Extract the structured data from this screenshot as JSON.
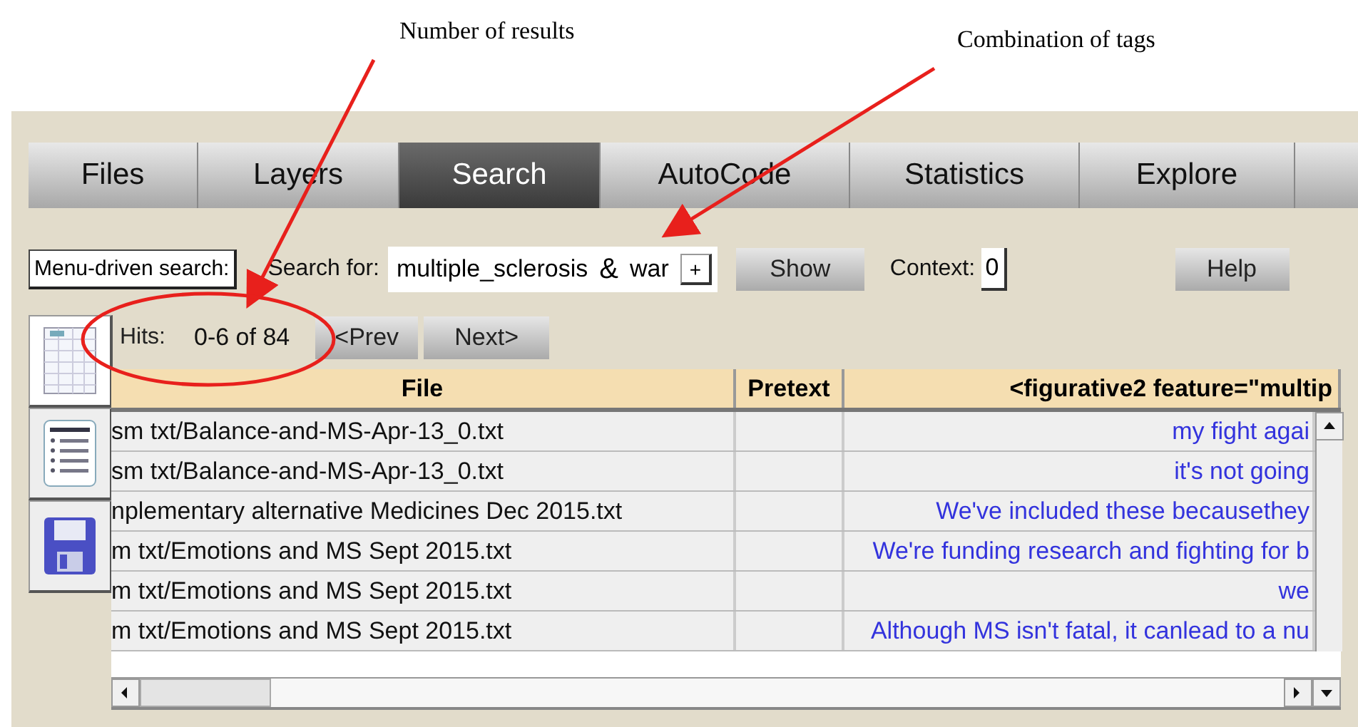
{
  "annotations": [
    {
      "label": "Number of results"
    },
    {
      "label": "Combination of tags"
    }
  ],
  "tabs": [
    {
      "label": "Files",
      "selected": false
    },
    {
      "label": "Layers",
      "selected": false
    },
    {
      "label": "Search",
      "selected": true
    },
    {
      "label": "AutoCode",
      "selected": false
    },
    {
      "label": "Statistics",
      "selected": false
    },
    {
      "label": "Explore",
      "selected": false
    }
  ],
  "search_bar": {
    "mode_button": "Menu-driven search:",
    "search_label": "Search for:",
    "terms": [
      "multiple_sclerosis",
      "war"
    ],
    "operator": "&",
    "add_button": "+",
    "show_button": "Show",
    "context_label": "Context:",
    "context_value": "0",
    "help_button": "Help"
  },
  "hits": {
    "label": "Hits:",
    "count": "0-6 of 84",
    "prev_button": "<Prev",
    "next_button": "Next>"
  },
  "table": {
    "columns": [
      "File",
      "Pretext",
      "<figurative2 feature=\"multip"
    ],
    "rows": [
      {
        "file": "sm txt/Balance-and-MS-Apr-13_0.txt",
        "pretext": "",
        "match": "my fight agai"
      },
      {
        "file": "sm txt/Balance-and-MS-Apr-13_0.txt",
        "pretext": "",
        "match": "it's not going"
      },
      {
        "file": "nplementary alternative Medicines Dec 2015.txt",
        "pretext": "",
        "match": "We've included these becausethey"
      },
      {
        "file": "m txt/Emotions and MS Sept 2015.txt",
        "pretext": "",
        "match": "We're funding research and fighting for b"
      },
      {
        "file": "m txt/Emotions and MS Sept 2015.txt",
        "pretext": "",
        "match": "we"
      },
      {
        "file": "m txt/Emotions and MS Sept 2015.txt",
        "pretext": "",
        "match": "Although MS isn't fatal, it canlead to a nu"
      }
    ]
  }
}
